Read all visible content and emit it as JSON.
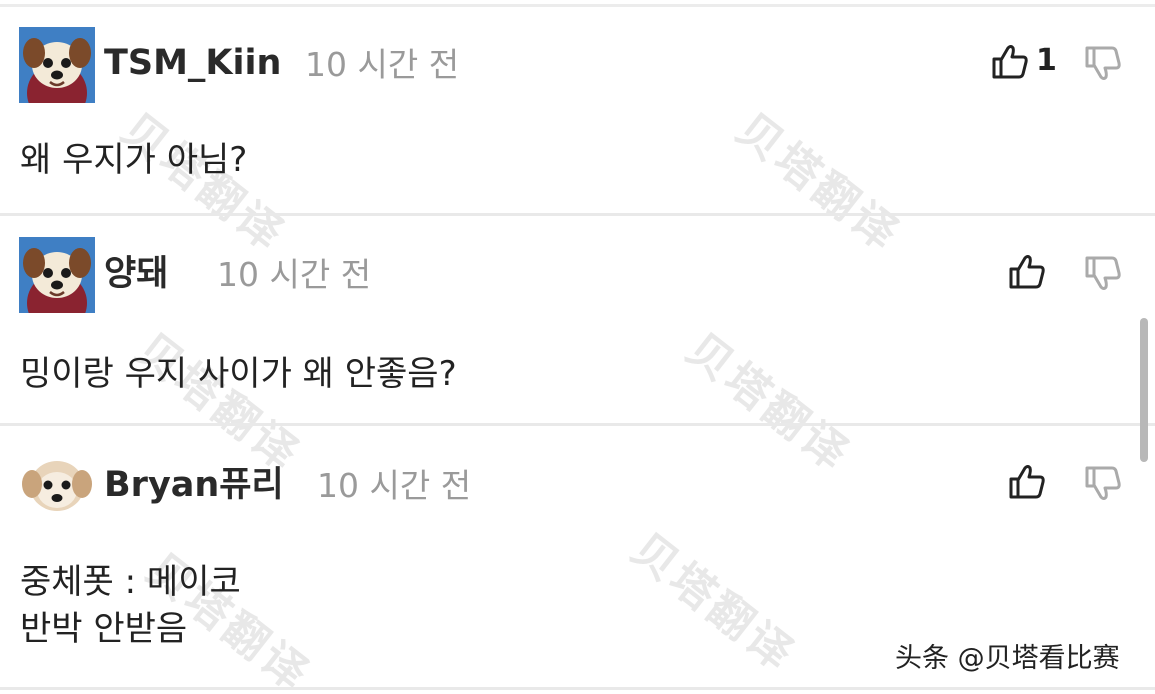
{
  "comments": [
    {
      "username": "TSM_Kiin",
      "time": "10 시간 전",
      "body": [
        "왜 우지가 아님?"
      ],
      "likes": "1",
      "avatar_icon": "dog-avatar-red-blue"
    },
    {
      "username": "양돼",
      "time": "10 시간 전",
      "body": [
        "밍이랑 우지 사이가 왜 안좋음?"
      ],
      "likes": "",
      "avatar_icon": "dog-avatar-red-blue"
    },
    {
      "username": "Bryan퓨리",
      "time": "10 시간 전",
      "body": [
        "중체폿 : 메이코",
        "반박 안받음"
      ],
      "likes": "",
      "avatar_icon": "puppy-avatar-white"
    }
  ],
  "watermark": "贝塔翻译",
  "credit": "头条 @贝塔看比赛",
  "colors": {
    "divider": "#e9e9e9",
    "time_text": "#9a9a9a",
    "icon_stroke": "#222222",
    "dislike_stroke": "#aaaaaa"
  }
}
